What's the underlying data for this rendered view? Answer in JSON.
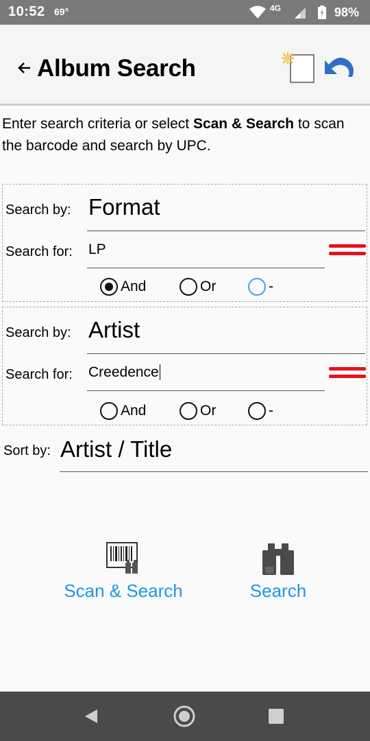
{
  "status_bar": {
    "time": "10:52",
    "temperature": "69°",
    "network": "4G",
    "battery": "98%"
  },
  "app_bar": {
    "title": "Album Search"
  },
  "intro": {
    "text_before": "Enter search criteria or select ",
    "bold": "Scan & Search",
    "text_after": " to scan the barcode and search by UPC."
  },
  "criteria": [
    {
      "search_by_label": "Search by:",
      "search_by_value": "Format",
      "search_for_label": "Search for:",
      "search_for_value": "LP",
      "options": [
        "And",
        "Or",
        "-"
      ],
      "selected": "And"
    },
    {
      "search_by_label": "Search by:",
      "search_by_value": "Artist",
      "search_for_label": "Search for:",
      "search_for_value": "Creedence",
      "options": [
        "And",
        "Or",
        "-"
      ],
      "selected": ""
    }
  ],
  "sort": {
    "label": "Sort by:",
    "value": "Artist / Title"
  },
  "actions": {
    "scan_label": "Scan & Search",
    "search_label": "Search"
  },
  "colors": {
    "accent": "#2196e0",
    "remove": "#e8101a",
    "undo": "#2f6fc4"
  }
}
